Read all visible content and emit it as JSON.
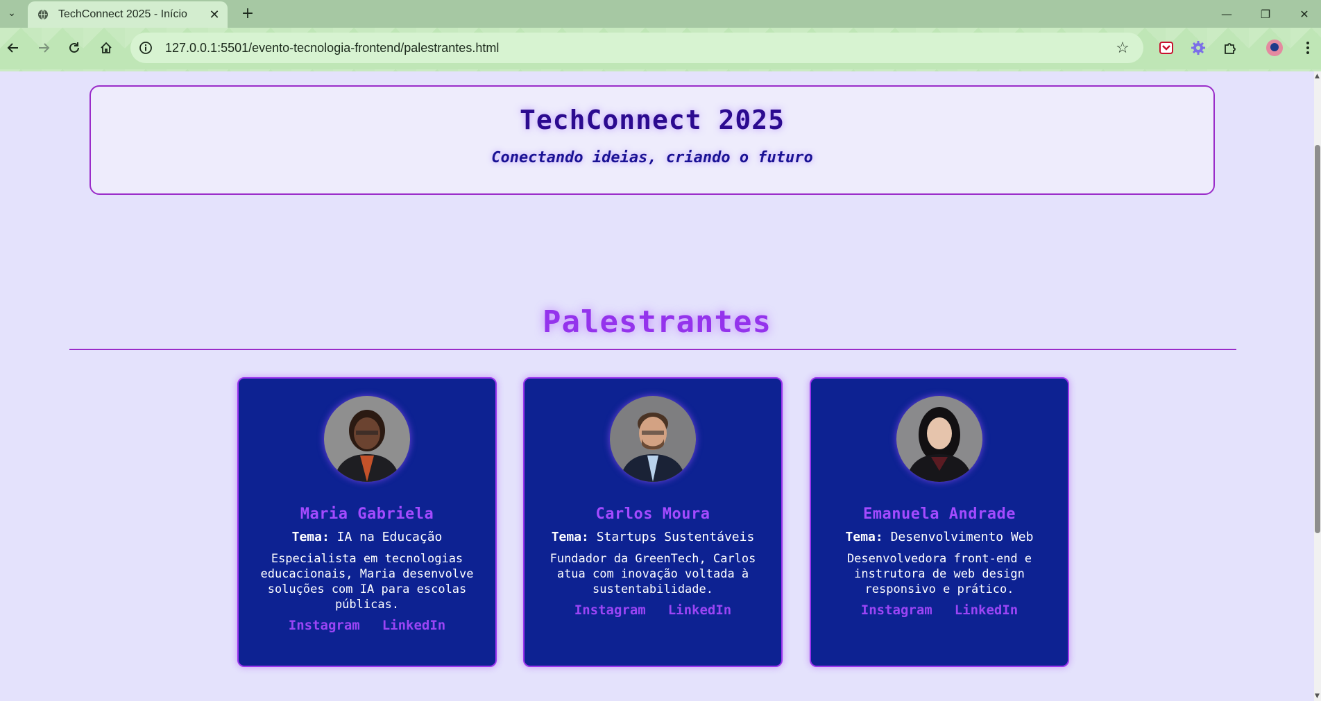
{
  "browser": {
    "tab_title": "TechConnect 2025 - Início",
    "url": "127.0.0.1:5501/evento-tecnologia-frontend/palestrantes.html"
  },
  "header": {
    "title": "TechConnect 2025",
    "slogan": "Conectando ideias, criando o futuro"
  },
  "section": {
    "title": "Palestrantes"
  },
  "speakers": [
    {
      "name": "Maria Gabriela",
      "topic_label": "Tema:",
      "topic": "IA na Educação",
      "bio": "Especialista em tecnologias educacionais, Maria desenvolve soluções com IA para escolas públicas.",
      "instagram": "Instagram",
      "linkedin": "LinkedIn"
    },
    {
      "name": "Carlos Moura",
      "topic_label": "Tema:",
      "topic": "Startups Sustentáveis",
      "bio": "Fundador da GreenTech, Carlos atua com inovação voltada à sustentabilidade.",
      "instagram": "Instagram",
      "linkedin": "LinkedIn"
    },
    {
      "name": "Emanuela Andrade",
      "topic_label": "Tema:",
      "topic": "Desenvolvimento Web",
      "bio": "Desenvolvedora front-end e instrutora de web design responsivo e prático.",
      "instagram": "Instagram",
      "linkedin": "LinkedIn"
    }
  ],
  "colors": {
    "page_background": "#e4e2fc",
    "accent_purple": "#9433ec",
    "card_background": "#0d2292",
    "title_color": "#2b0a8f"
  }
}
